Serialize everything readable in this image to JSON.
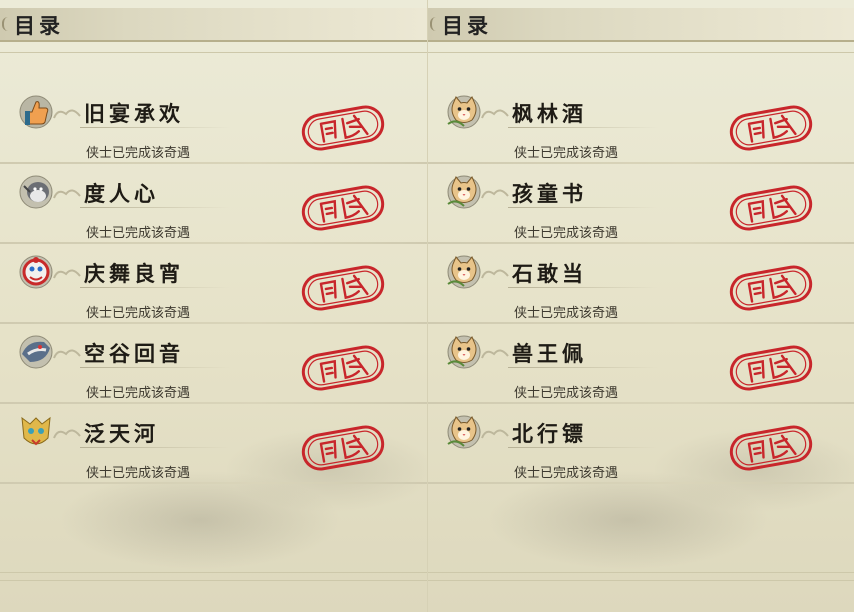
{
  "panels": [
    {
      "title": "目录",
      "items": [
        {
          "name": "旧宴承欢",
          "status": "侠士已完成该奇遇",
          "icon": "thumbs-up-icon"
        },
        {
          "name": "度人心",
          "status": "侠士已完成该奇遇",
          "icon": "gray-bird-icon"
        },
        {
          "name": "庆舞良宵",
          "status": "侠士已完成该奇遇",
          "icon": "lion-dance-icon"
        },
        {
          "name": "空谷回音",
          "status": "侠士已完成该奇遇",
          "icon": "dragon-head-icon"
        },
        {
          "name": "泛天河",
          "status": "侠士已完成该奇遇",
          "icon": "golden-mask-icon"
        }
      ]
    },
    {
      "title": "目录",
      "items": [
        {
          "name": "枫林酒",
          "status": "侠士已完成该奇遇",
          "icon": "cat-icon"
        },
        {
          "name": "孩童书",
          "status": "侠士已完成该奇遇",
          "icon": "cat-icon"
        },
        {
          "name": "石敢当",
          "status": "侠士已完成该奇遇",
          "icon": "cat-icon"
        },
        {
          "name": "兽王佩",
          "status": "侠士已完成该奇遇",
          "icon": "cat-icon"
        },
        {
          "name": "北行镖",
          "status": "侠士已完成该奇遇",
          "icon": "cat-icon"
        }
      ]
    }
  ],
  "stamp_text": "完成",
  "colors": {
    "stamp": "#c8262b",
    "background": "#e8e3cd",
    "text": "#1e1b15"
  }
}
